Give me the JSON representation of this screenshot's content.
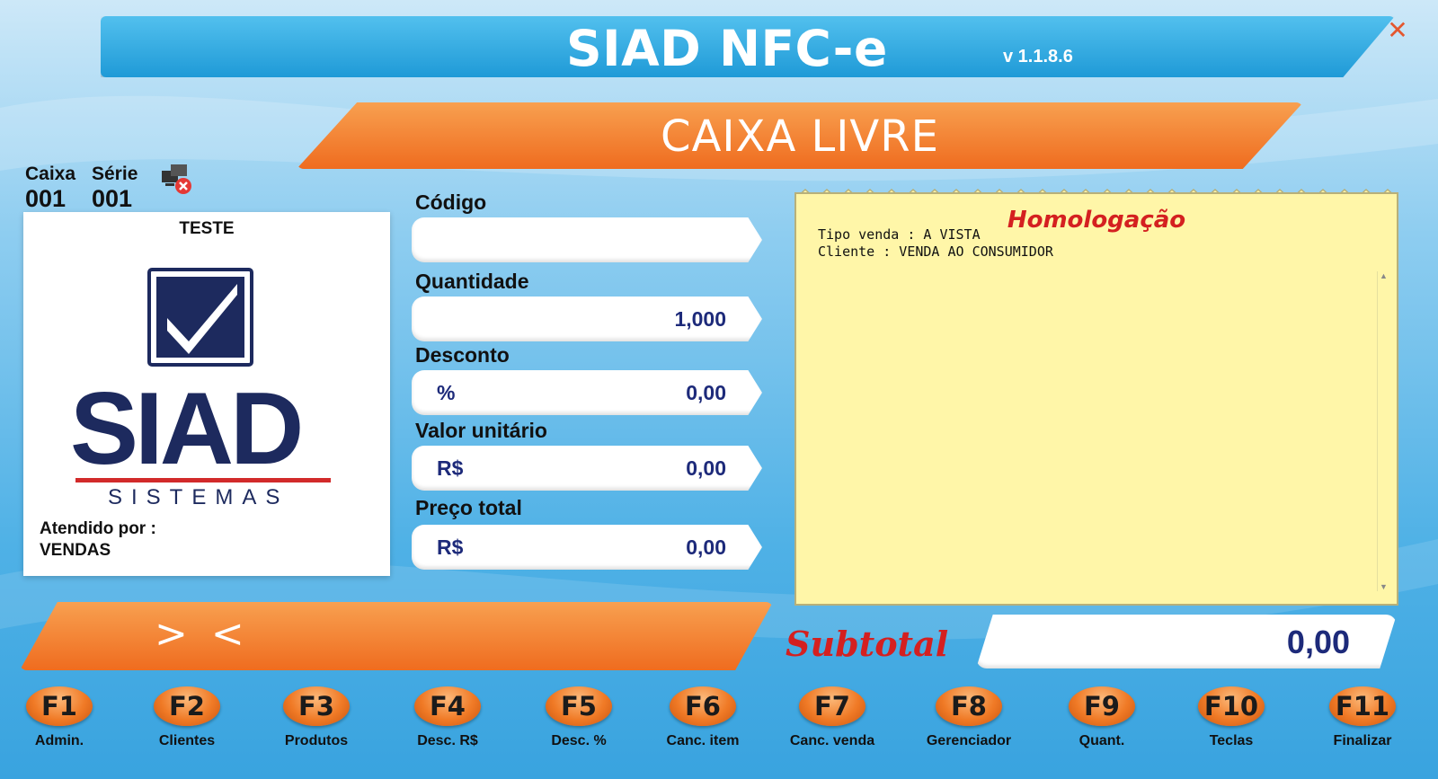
{
  "window": {
    "title": "SIAD NFC-e",
    "version": "v 1.1.8.6",
    "close_glyph": "✕"
  },
  "status": {
    "text": "CAIXA LIVRE"
  },
  "register": {
    "caixa_label": "Caixa",
    "caixa_value": "001",
    "serie_label": "Série",
    "serie_value": "001",
    "network_icon": "network-disconnected-icon"
  },
  "logo_panel": {
    "title": "TESTE",
    "logo_word": "SIAD",
    "logo_sub": "SISTEMAS",
    "attended_label": "Atendido por :",
    "attended_value": "VENDAS"
  },
  "fields": {
    "codigo": {
      "label": "Código",
      "value": ""
    },
    "quantidade": {
      "label": "Quantidade",
      "value": "1,000"
    },
    "desconto": {
      "label": "Desconto",
      "prefix": "%",
      "value": "0,00"
    },
    "valor_unitario": {
      "label": "Valor unitário",
      "prefix": "R$",
      "value": "0,00"
    },
    "preco_total": {
      "label": "Preço total",
      "prefix": "R$",
      "value": "0,00"
    }
  },
  "receipt": {
    "title": "Homologação",
    "line1": "Tipo venda : A VISTA",
    "line2": "Cliente : VENDA AO CONSUMIDOR"
  },
  "message_bar": {
    "text": "> <"
  },
  "subtotal": {
    "label": "Subtotal",
    "value": "0,00"
  },
  "function_keys": [
    {
      "key": "F1",
      "label": "Admin."
    },
    {
      "key": "F2",
      "label": "Clientes"
    },
    {
      "key": "F3",
      "label": "Produtos"
    },
    {
      "key": "F4",
      "label": "Desc. R$"
    },
    {
      "key": "F5",
      "label": "Desc. %"
    },
    {
      "key": "F6",
      "label": "Canc. item"
    },
    {
      "key": "F7",
      "label": "Canc. venda"
    },
    {
      "key": "F8",
      "label": "Gerenciador"
    },
    {
      "key": "F9",
      "label": "Quant."
    },
    {
      "key": "F10",
      "label": "Teclas"
    },
    {
      "key": "F11",
      "label": "Finalizar"
    }
  ],
  "colors": {
    "accent_orange": "#ef6c1f",
    "title_blue": "#1f9ad7",
    "receipt_bg": "#fff6a8",
    "alert_red": "#d42020",
    "value_navy": "#1d2a7a"
  }
}
